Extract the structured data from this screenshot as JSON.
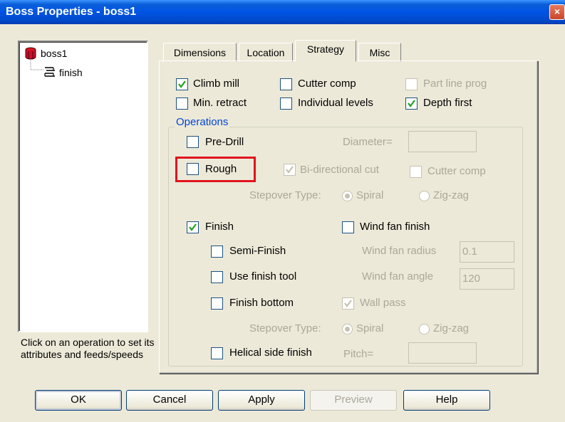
{
  "window": {
    "title": "Boss Properties - boss1",
    "close_glyph": "×"
  },
  "tree": {
    "root": {
      "label": "boss1",
      "icon": "cylinder-icon"
    },
    "child": {
      "label": "finish",
      "icon": "finish-toolpath-icon"
    }
  },
  "hint": "Click on an operation to set its attributes and feeds/speeds",
  "tabs": [
    {
      "label": "Dimensions",
      "active": false
    },
    {
      "label": "Location",
      "active": false
    },
    {
      "label": "Strategy",
      "active": true
    },
    {
      "label": "Misc",
      "active": false
    }
  ],
  "strategy": {
    "climb_mill": {
      "label": "Climb mill",
      "checked": true
    },
    "cutter_comp": {
      "label": "Cutter comp",
      "checked": false
    },
    "part_line_prog": {
      "label": "Part line prog",
      "checked": false,
      "disabled": true
    },
    "min_retract": {
      "label": "Min. retract",
      "checked": false
    },
    "individual_levels": {
      "label": "Individual levels",
      "checked": false
    },
    "depth_first": {
      "label": "Depth first",
      "checked": true
    }
  },
  "operations": {
    "title": "Operations",
    "pre_drill": {
      "label": "Pre-Drill",
      "checked": false
    },
    "diameter_label": "Diameter=",
    "diameter_value": "",
    "rough": {
      "label": "Rough",
      "checked": false
    },
    "bidirectional": {
      "label": "Bi-directional cut",
      "checked": true,
      "disabled": true
    },
    "rough_cutter_comp": {
      "label": "Cutter comp",
      "checked": false,
      "disabled": true
    },
    "stepover_label": "Stepover Type:",
    "spiral_label": "Spiral",
    "zigzag_label": "Zig-zag",
    "finish": {
      "label": "Finish",
      "checked": true
    },
    "wind_fan_finish": {
      "label": "Wind fan finish",
      "checked": false
    },
    "semi_finish": {
      "label": "Semi-Finish",
      "checked": false
    },
    "wind_fan_radius_label": "Wind fan radius",
    "wind_fan_radius_value": "0.1",
    "use_finish_tool": {
      "label": "Use finish tool",
      "checked": false
    },
    "wind_fan_angle_label": "Wind fan angle",
    "wind_fan_angle_value": "120",
    "finish_bottom": {
      "label": "Finish bottom",
      "checked": false
    },
    "wall_pass": {
      "label": "Wall pass",
      "checked": true,
      "disabled": true
    },
    "stepover2_label": "Stepover Type:",
    "spiral2_label": "Spiral",
    "zigzag2_label": "Zig-zag",
    "helical": {
      "label": "Helical side finish",
      "checked": false
    },
    "pitch_label": "Pitch=",
    "pitch_value": ""
  },
  "buttons": {
    "ok": "OK",
    "cancel": "Cancel",
    "apply": "Apply",
    "preview": "Preview",
    "help": "Help"
  },
  "colors": {
    "title_bar": "#0054e3",
    "highlight": "#e0141e",
    "group_title": "#0046d5"
  }
}
